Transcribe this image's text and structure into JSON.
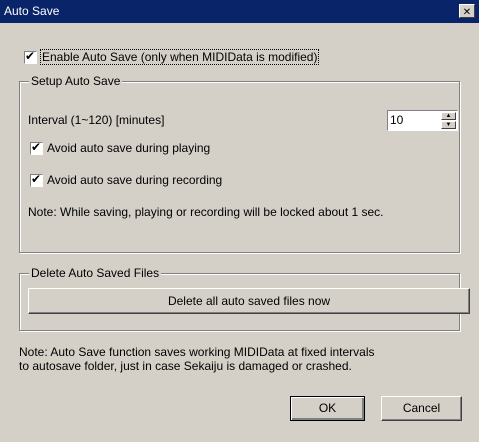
{
  "window": {
    "title": "Auto Save",
    "close_glyph": "✕"
  },
  "enable": {
    "label": "Enable Auto Save (only when MIDIData is modified)",
    "checked": true
  },
  "setup": {
    "group_title": "Setup Auto Save",
    "interval_label": "Interval (1~120) [minutes]",
    "interval_value": "10",
    "avoid_playing_label": "Avoid auto save during playing",
    "avoid_playing_checked": true,
    "avoid_recording_label": "Avoid auto save during recording",
    "avoid_recording_checked": true,
    "note": "Note: While saving, playing or recording will be locked about 1 sec."
  },
  "delete": {
    "group_title": "Delete Auto Saved Files",
    "button_label": "Delete all auto saved files now"
  },
  "footer": {
    "note_line1": "Note: Auto Save function saves working MIDIData at fixed intervals",
    "note_line2": "to autosave folder, just in case Sekaiju is damaged or crashed."
  },
  "buttons": {
    "ok": "OK",
    "cancel": "Cancel"
  },
  "icons": {
    "check": "checkmark-icon",
    "spin_up": "spin-up-arrow-icon",
    "spin_down": "spin-down-arrow-icon"
  },
  "colors": {
    "titlebar": "#0a246a",
    "dialog_face": "#d4d0c8"
  }
}
